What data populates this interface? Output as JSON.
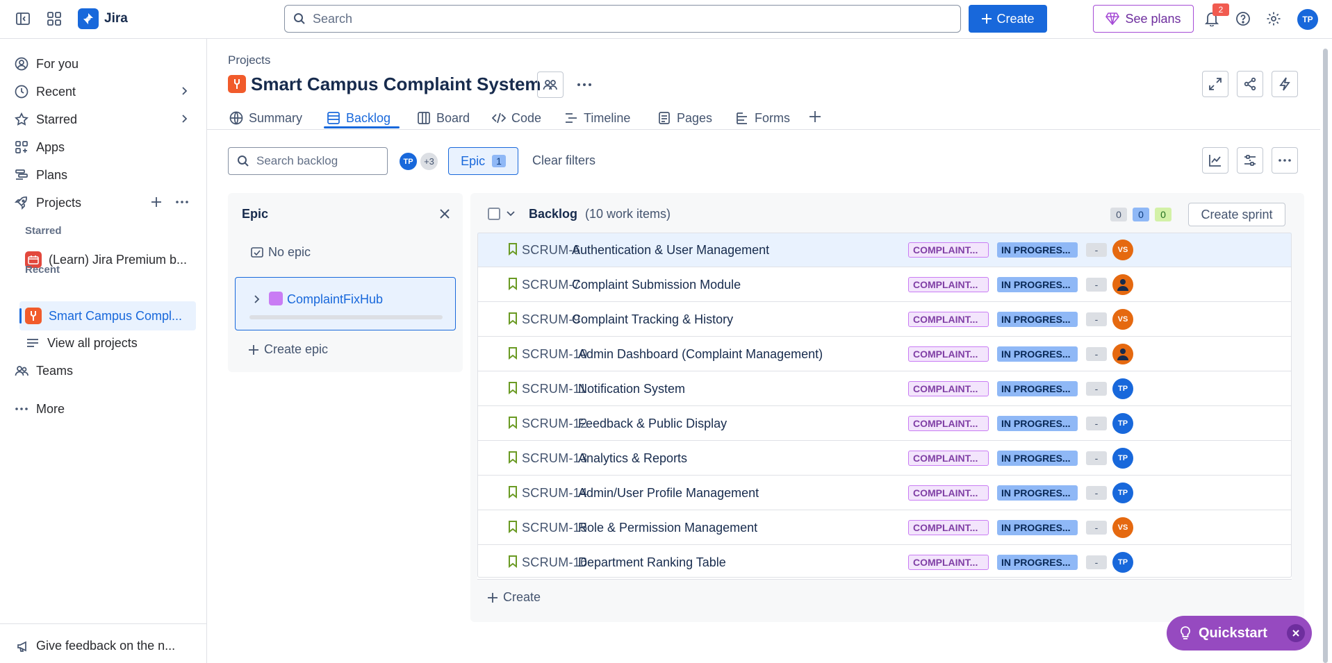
{
  "app": {
    "title": "Jira"
  },
  "topbar": {
    "search_placeholder": "Search",
    "create_label": "Create",
    "see_plans_label": "See plans",
    "notification_count": "2",
    "user_initials": "TP"
  },
  "sidebar": {
    "items": [
      {
        "label": "For you",
        "icon": "user-circle-icon"
      },
      {
        "label": "Recent",
        "icon": "clock-icon"
      },
      {
        "label": "Starred",
        "icon": "star-icon"
      },
      {
        "label": "Apps",
        "icon": "apps-icon"
      },
      {
        "label": "Plans",
        "icon": "plans-icon"
      },
      {
        "label": "Projects",
        "icon": "rocket-icon"
      }
    ],
    "starred_heading": "Starred",
    "starred_project": "(Learn) Jira Premium b...",
    "recent_heading": "Recent",
    "recent_project": "Smart Campus Compl...",
    "view_all": "View all projects",
    "teams": "Teams",
    "more": "More",
    "feedback": "Give feedback on the n..."
  },
  "header": {
    "breadcrumb": "Projects",
    "project_title": "Smart Campus Complaint System"
  },
  "tabs": [
    {
      "label": "Summary",
      "icon": "globe-icon"
    },
    {
      "label": "Backlog",
      "icon": "backlog-icon"
    },
    {
      "label": "Board",
      "icon": "board-icon"
    },
    {
      "label": "Code",
      "icon": "code-icon"
    },
    {
      "label": "Timeline",
      "icon": "timeline-icon"
    },
    {
      "label": "Pages",
      "icon": "pages-icon"
    },
    {
      "label": "Forms",
      "icon": "forms-icon"
    }
  ],
  "toolbar": {
    "search_placeholder": "Search backlog",
    "avatar_initials": "TP",
    "avatar_more": "+3",
    "epic_filter_label": "Epic",
    "epic_filter_count": "1",
    "clear_filters": "Clear filters"
  },
  "epic_panel": {
    "title": "Epic",
    "no_epic": "No epic",
    "epic_name": "ComplaintFixHub",
    "create_epic": "Create epic"
  },
  "backlog": {
    "title": "Backlog",
    "count": "(10 work items)",
    "points_todo": "0",
    "points_inprogress": "0",
    "points_done": "0",
    "create_sprint": "Create sprint",
    "create_label": "Create",
    "items": [
      {
        "key": "SCRUM-6",
        "summary": "Authentication & User Management",
        "epic": "COMPLAINT...",
        "status": "IN PROGRES...",
        "estimate": "-",
        "assignee": "VS",
        "assignee_type": "vs"
      },
      {
        "key": "SCRUM-7",
        "summary": "Complaint Submission Module",
        "epic": "COMPLAINT...",
        "status": "IN PROGRES...",
        "estimate": "-",
        "assignee": "",
        "assignee_type": "unassigned"
      },
      {
        "key": "SCRUM-9",
        "summary": "Complaint Tracking & History",
        "epic": "COMPLAINT...",
        "status": "IN PROGRES...",
        "estimate": "-",
        "assignee": "VS",
        "assignee_type": "vs"
      },
      {
        "key": "SCRUM-10",
        "summary": "Admin Dashboard (Complaint Management)",
        "epic": "COMPLAINT...",
        "status": "IN PROGRES...",
        "estimate": "-",
        "assignee": "",
        "assignee_type": "unassigned"
      },
      {
        "key": "SCRUM-11",
        "summary": "Notification System",
        "epic": "COMPLAINT...",
        "status": "IN PROGRES...",
        "estimate": "-",
        "assignee": "TP",
        "assignee_type": "tp"
      },
      {
        "key": "SCRUM-12",
        "summary": "Feedback & Public Display",
        "epic": "COMPLAINT...",
        "status": "IN PROGRES...",
        "estimate": "-",
        "assignee": "TP",
        "assignee_type": "tp"
      },
      {
        "key": "SCRUM-13",
        "summary": "Analytics & Reports",
        "epic": "COMPLAINT...",
        "status": "IN PROGRES...",
        "estimate": "-",
        "assignee": "TP",
        "assignee_type": "tp"
      },
      {
        "key": "SCRUM-14",
        "summary": "Admin/User Profile Management",
        "epic": "COMPLAINT...",
        "status": "IN PROGRES...",
        "estimate": "-",
        "assignee": "TP",
        "assignee_type": "tp"
      },
      {
        "key": "SCRUM-15",
        "summary": "Role & Permission Management",
        "epic": "COMPLAINT...",
        "status": "IN PROGRES...",
        "estimate": "-",
        "assignee": "VS",
        "assignee_type": "vs"
      },
      {
        "key": "SCRUM-16",
        "summary": "Department Ranking Table",
        "epic": "COMPLAINT...",
        "status": "IN PROGRES...",
        "estimate": "-",
        "assignee": "TP",
        "assignee_type": "tp"
      }
    ]
  },
  "quickstart": {
    "label": "Quickstart"
  },
  "colors": {
    "brand": "#1868db",
    "avatar_tp": "#1868db",
    "avatar_vs": "#e56910",
    "avatar_unassigned": "#e56910",
    "quickstart": "#964ac0"
  }
}
